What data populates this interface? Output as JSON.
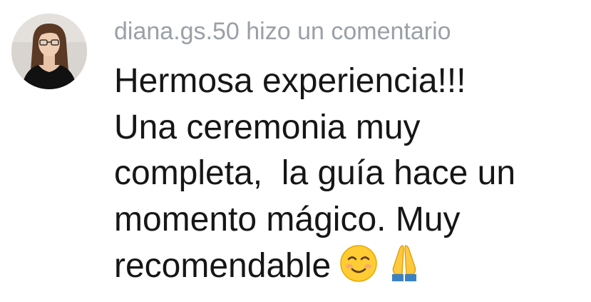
{
  "comment": {
    "author": "diana.gs.50",
    "action_text": "hizo un comentario",
    "body_lines": [
      "Hermosa experiencia!!!",
      "Una ceremonia muy",
      "completa,  la guía hace un",
      "momento mágico. Muy",
      "recomendable"
    ],
    "emojis": [
      "smiling-face-icon",
      "folded-hands-icon"
    ]
  },
  "colors": {
    "header_text": "#9aa0a6",
    "body_text": "#161616",
    "background": "#ffffff"
  }
}
